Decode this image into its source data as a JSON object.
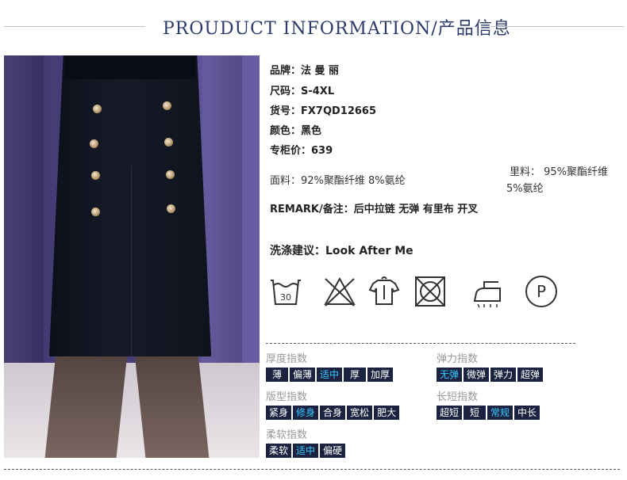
{
  "header": {
    "title": "PROUDUCT INFORMATION/产品信息"
  },
  "product": {
    "brand": "品牌：法 曼 丽",
    "size": "尺码：S-4XL",
    "item_no": "货号：FX7QD12665",
    "color": "颜色：黑色",
    "price": "专柜价：639",
    "fabric": "面料：92%聚酯纤维 8%氨纶",
    "lining_line1": "里料： 95%聚酯纤维",
    "lining_line2": "5%氨纶",
    "remark": "REMARK/备注：后中拉链 无弹 有里布 开叉"
  },
  "care": {
    "label": "洗涤建议：Look After Me",
    "icons": [
      "wash-30-icon",
      "no-bleach-icon",
      "hang-dry-icon",
      "no-tumble-dry-icon",
      "iron-icon",
      "dry-clean-p-icon"
    ],
    "wash_temp": "30",
    "dry_clean_letter": "P"
  },
  "indices": {
    "thickness": {
      "title": "厚度指数",
      "options": [
        "薄",
        "偏薄",
        "适中",
        "厚",
        "加厚"
      ],
      "active": 2
    },
    "elasticity": {
      "title": "弹力指数",
      "options": [
        "无弹",
        "微弹",
        "弹力",
        "超弹"
      ],
      "active": 0
    },
    "fit": {
      "title": "版型指数",
      "options": [
        "紧身",
        "修身",
        "合身",
        "宽松",
        "肥大"
      ],
      "active": 1
    },
    "length": {
      "title": "长短指数",
      "options": [
        "超短",
        "短",
        "常规",
        "中长"
      ],
      "active": 2
    },
    "softness": {
      "title": "柔软指数",
      "options": [
        "柔软",
        "适中",
        "偏硬"
      ],
      "active": 1
    }
  },
  "colors": {
    "header_text": "#2b3a6b",
    "index_bg": "#1c2340",
    "index_active": "#33c8ff"
  }
}
